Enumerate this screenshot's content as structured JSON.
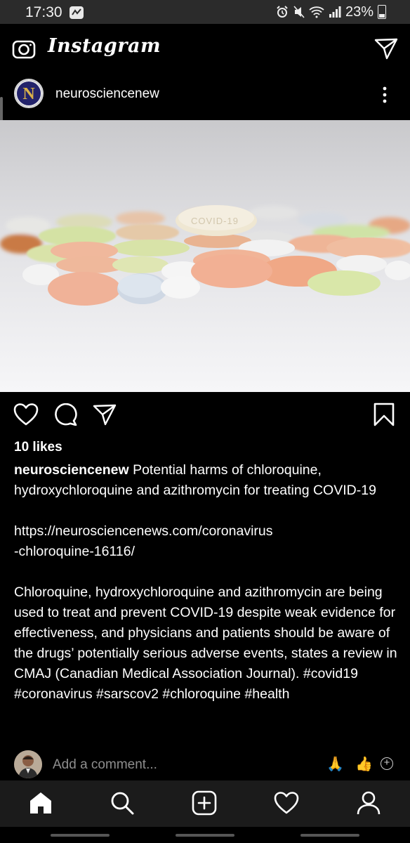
{
  "status_bar": {
    "time": "17:30",
    "battery": "23%"
  },
  "app": {
    "brand": "Instagram",
    "camera_icon": "camera-icon",
    "direct_icon": "paper-plane-icon"
  },
  "post": {
    "username": "neurosciencenew",
    "avatar_initials": "N",
    "image_label": "COVID-19",
    "likes": "10 likes",
    "caption_user": "neurosciencenew",
    "caption_text": " Potential harms of chloroquine, hydroxychloroquine and azithromycin for treating COVID-19\n\nhttps://neurosciencenews.com/coronavirus\n-chloroquine-16116/\n\nChloroquine, hydroxychloroquine and azithromycin are being used to treat and prevent COVID-19 despite weak evidence for effectiveness, and physicians and patients should be aware of the drugs’ potentially serious adverse events, states a review in CMAJ (Canadian Medical Association Journal). #covid19 #coronavirus #sarscov2 #chloroquine #health"
  },
  "comment": {
    "placeholder": "Add a comment...",
    "emoji_1": "🙏",
    "emoji_2": "👍",
    "add_symbol": "+"
  },
  "nav": {
    "items": [
      "home-icon",
      "search-icon",
      "add-post-icon",
      "activity-heart-icon",
      "profile-icon"
    ]
  },
  "colors": {
    "background": "#000000",
    "status_bar": "#2b2b2b",
    "bottom_nav": "#1b1b1b",
    "placeholder": "#8e8e8e"
  }
}
